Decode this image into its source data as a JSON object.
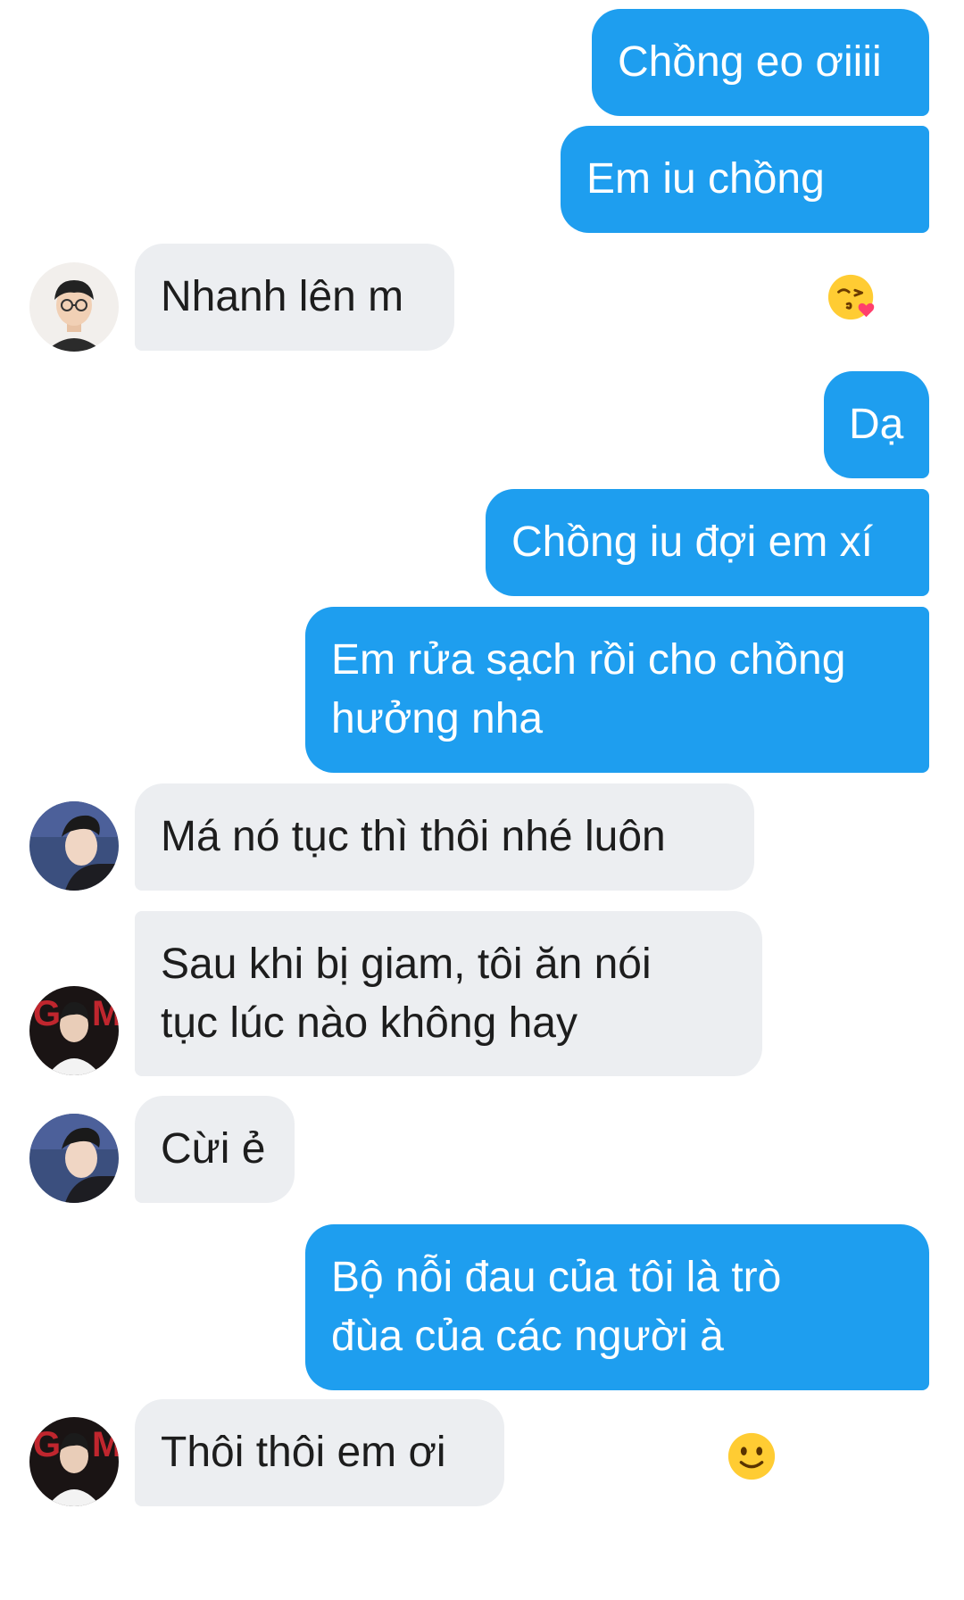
{
  "conversation": {
    "messages": [
      {
        "side": "sent",
        "text": "Chồng eo ơiiii"
      },
      {
        "side": "sent",
        "text": "Em iu chồng",
        "emoji": "kissing-heart-emoji"
      },
      {
        "side": "received",
        "avatar": "avatar-glasses-boy",
        "text": "Nhanh lên m"
      },
      {
        "side": "sent",
        "text": "Dạ"
      },
      {
        "side": "sent",
        "text": "Chồng iu đợi em xí"
      },
      {
        "side": "sent",
        "text": "Em rửa sạch rồi cho chồng\nhưởng nha"
      },
      {
        "side": "received",
        "avatar": "avatar-profile-boy",
        "text": "Má nó tục thì thôi nhé luôn"
      },
      {
        "side": "received",
        "avatar": "avatar-gam-boy",
        "text": "Sau khi bị giam, tôi ăn nói\ntục lúc nào không hay"
      },
      {
        "side": "received",
        "avatar": "avatar-profile-boy",
        "text": "Cừi ẻ"
      },
      {
        "side": "sent",
        "text": "Bộ nỗi đau của tôi là trò\nđùa của các người à",
        "emoji": "slightly-smiling-emoji"
      },
      {
        "side": "received",
        "avatar": "avatar-gam-boy",
        "text": "Thôi thôi em ơi"
      }
    ]
  },
  "colors": {
    "sent_bubble": "#1e9eef",
    "received_bubble": "#eceef1",
    "sent_text": "#ffffff",
    "received_text": "#1d1d1d"
  }
}
